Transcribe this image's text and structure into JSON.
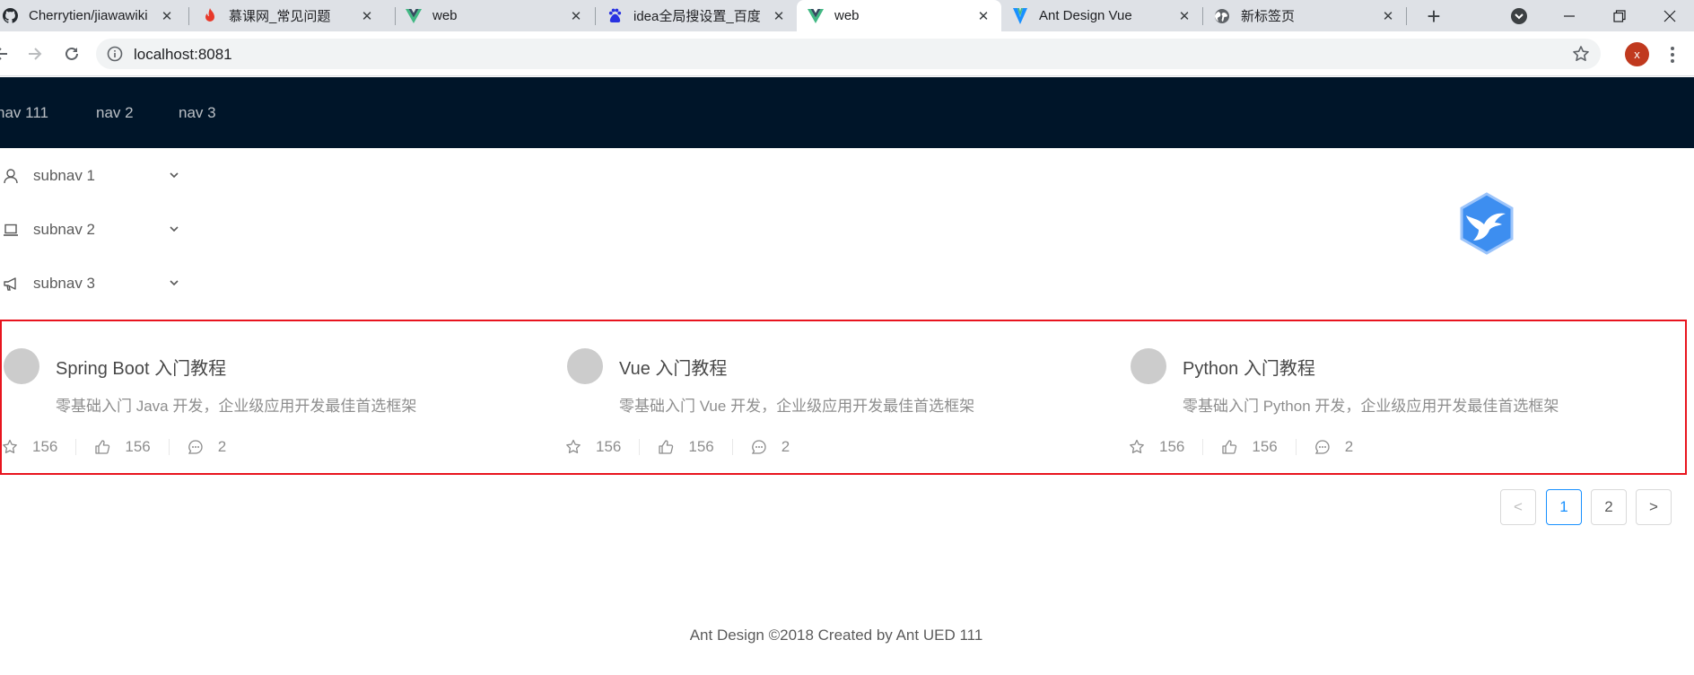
{
  "browser": {
    "tabs": [
      {
        "title": "Cherrytien/jiawawiki",
        "icon": "github-icon",
        "active": false
      },
      {
        "title": "慕课网_常见问题",
        "icon": "flame-icon",
        "active": false
      },
      {
        "title": "web",
        "icon": "vue-icon",
        "active": false
      },
      {
        "title": "idea全局搜设置_百度",
        "icon": "baidu-icon",
        "active": false
      },
      {
        "title": "web",
        "icon": "vue-icon",
        "active": true
      },
      {
        "title": "Ant Design Vue",
        "icon": "antdv-icon",
        "active": false
      },
      {
        "title": "新标签页",
        "icon": "globe-icon",
        "active": false
      }
    ],
    "url": "localhost:8081",
    "profile_initial": "x",
    "colors": {
      "tab_strip": "#dee1e6",
      "profile": "#c0391e"
    }
  },
  "header": {
    "nav": [
      "nav 111",
      "nav 2",
      "nav 3"
    ],
    "background": "#001529"
  },
  "sidebar": {
    "items": [
      {
        "label": "subnav 1",
        "icon": "user-icon"
      },
      {
        "label": "subnav 2",
        "icon": "laptop-icon"
      },
      {
        "label": "subnav 3",
        "icon": "notification-icon"
      }
    ]
  },
  "list": {
    "items": [
      {
        "title": "Spring Boot 入门教程",
        "description": "零基础入门 Java 开发，企业级应用开发最佳首选框架",
        "stars": "156",
        "likes": "156",
        "comments": "2"
      },
      {
        "title": "Vue 入门教程",
        "description": "零基础入门 Vue 开发，企业级应用开发最佳首选框架",
        "stars": "156",
        "likes": "156",
        "comments": "2"
      },
      {
        "title": "Python 入门教程",
        "description": "零基础入门 Python 开发，企业级应用开发最佳首选框架",
        "stars": "156",
        "likes": "156",
        "comments": "2"
      }
    ],
    "highlight_color": "#e8141e"
  },
  "pagination": {
    "prev": "<",
    "pages": [
      "1",
      "2"
    ],
    "current": "1",
    "next": ">",
    "accent": "#1890ff"
  },
  "footer": {
    "text": "Ant Design ©2018 Created by Ant UED 111"
  }
}
